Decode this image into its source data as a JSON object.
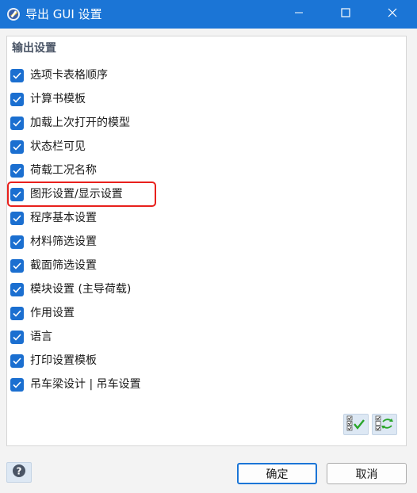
{
  "window": {
    "title": "导出 GUI 设置",
    "minimize_icon": "minimize-icon",
    "maximize_icon": "maximize-icon",
    "close_icon": "close-icon"
  },
  "section": {
    "title": "输出设置"
  },
  "options": [
    {
      "label": "选项卡表格顺序",
      "checked": true
    },
    {
      "label": "计算书模板",
      "checked": true
    },
    {
      "label": "加载上次打开的模型",
      "checked": true
    },
    {
      "label": "状态栏可见",
      "checked": true
    },
    {
      "label": "荷载工况名称",
      "checked": true
    },
    {
      "label": "图形设置/显示设置",
      "checked": true,
      "highlighted": true
    },
    {
      "label": "程序基本设置",
      "checked": true
    },
    {
      "label": "材料筛选设置",
      "checked": true
    },
    {
      "label": "截面筛选设置",
      "checked": true
    },
    {
      "label": "模块设置 (主导荷载)",
      "checked": true
    },
    {
      "label": "作用设置",
      "checked": true
    },
    {
      "label": "语言",
      "checked": true
    },
    {
      "label": "打印设置模板",
      "checked": true
    },
    {
      "label": "吊车梁设计 | 吊车设置",
      "checked": true
    }
  ],
  "toolbar": {
    "check_all_icon": "check-all-icon",
    "invert_selection_icon": "invert-selection-icon"
  },
  "footer": {
    "help_icon": "help-icon",
    "ok_label": "确定",
    "cancel_label": "取消"
  },
  "colors": {
    "titlebar": "#1b75d6",
    "checkbox": "#1b6fd0",
    "highlight": "#e8201c"
  }
}
